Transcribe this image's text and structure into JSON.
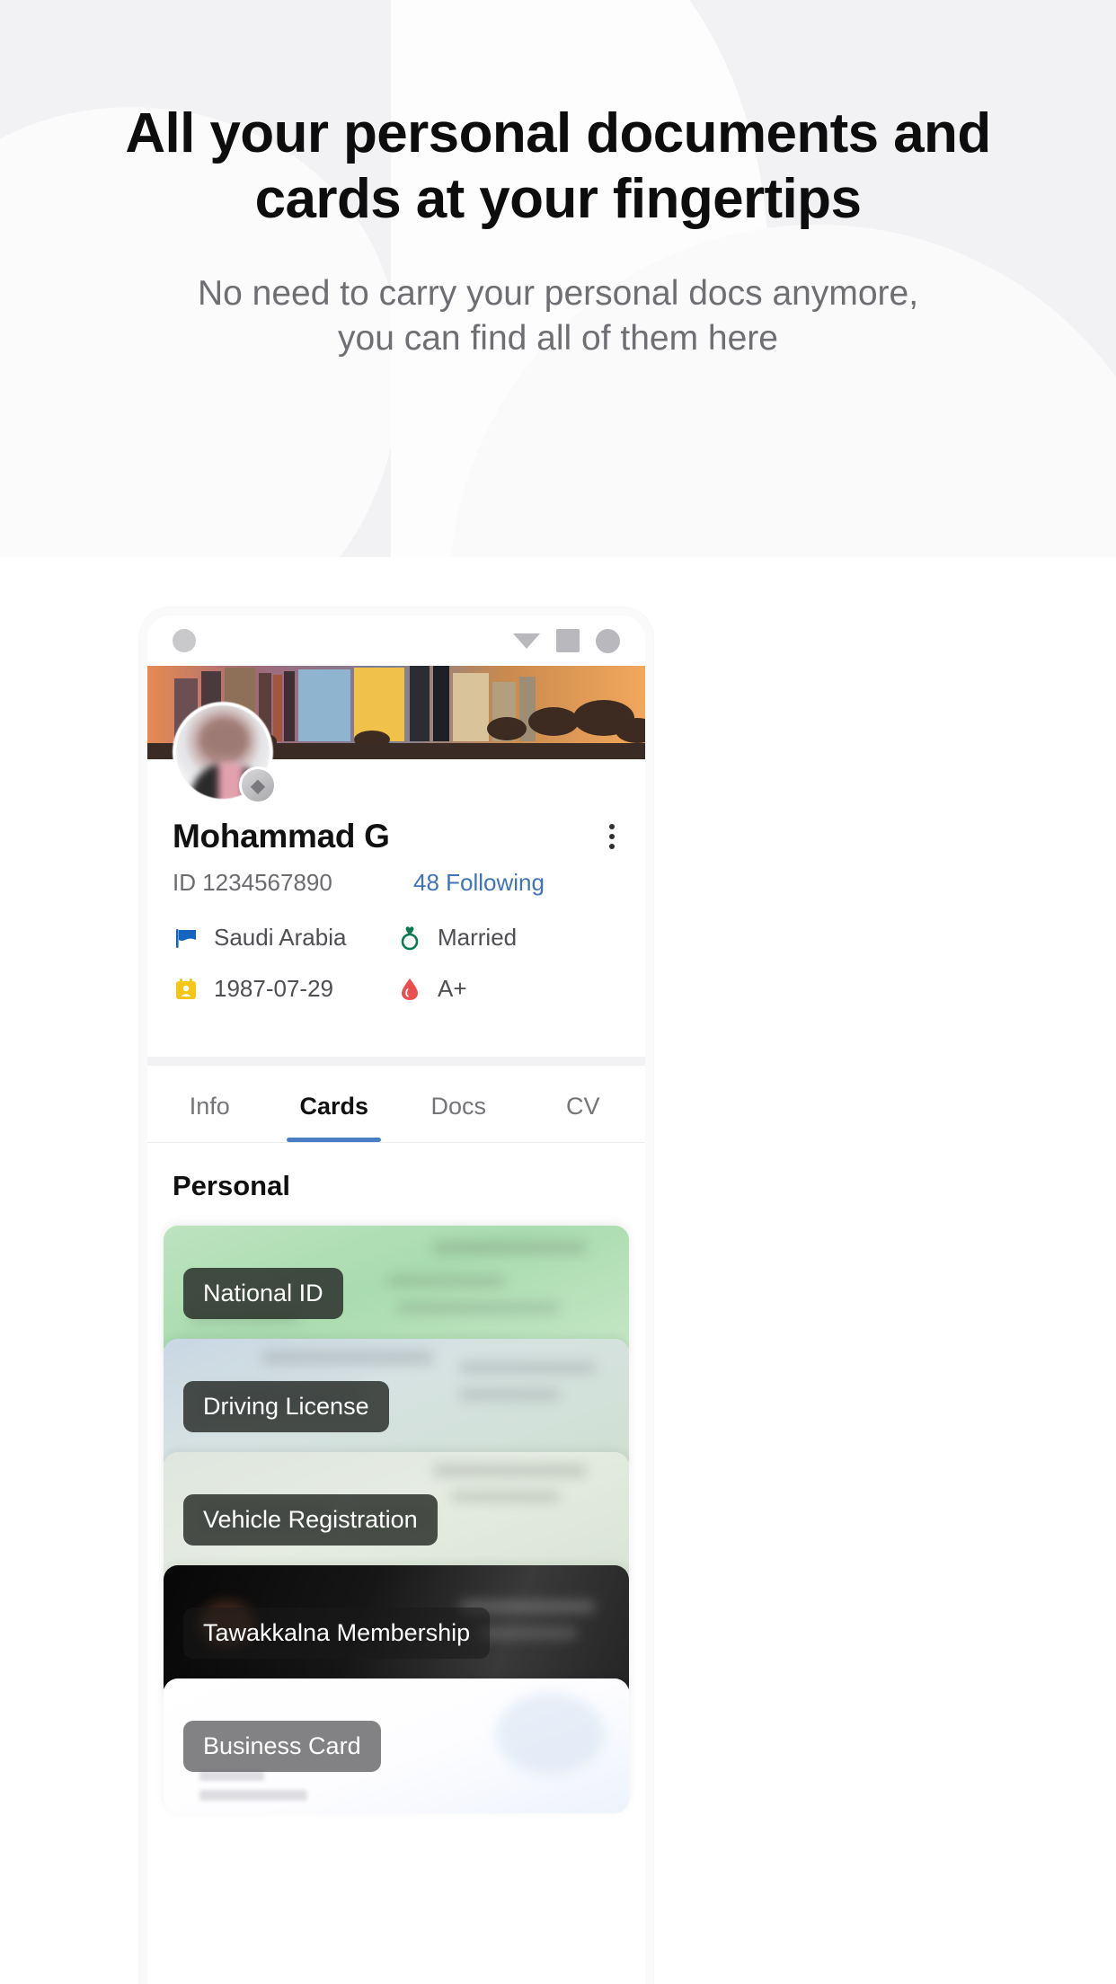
{
  "hero": {
    "headline": "All your personal documents and cards at your fingertips",
    "subheadline": "No need to carry your personal docs anymore, you can find all of them here"
  },
  "phone": {
    "statusbar": {
      "camera_icon": "camera-dot",
      "icons": [
        "triangle-icon",
        "square-icon",
        "circle-icon"
      ]
    },
    "profile": {
      "name": "Mohammad G",
      "id": "ID 1234567890",
      "following": "48 Following",
      "menu_icon": "kebab-menu-icon",
      "avatar_badge_icon": "verified-badge-icon",
      "facts": [
        {
          "icon": "flag-icon",
          "label": "Saudi Arabia"
        },
        {
          "icon": "ring-icon",
          "label": "Married"
        },
        {
          "icon": "calendar-person-icon",
          "label": "1987-07-29"
        },
        {
          "icon": "blood-drop-icon",
          "label": "A+"
        }
      ]
    },
    "tabs": [
      {
        "label": "Info",
        "active": false
      },
      {
        "label": "Cards",
        "active": true
      },
      {
        "label": "Docs",
        "active": false
      },
      {
        "label": "CV",
        "active": false
      }
    ],
    "cards_section": {
      "title": "Personal",
      "cards": [
        {
          "label": "National ID"
        },
        {
          "label": "Driving License"
        },
        {
          "label": "Vehicle Registration"
        },
        {
          "label": "Tawakkalna Membership"
        },
        {
          "label": "Business Card"
        }
      ]
    }
  },
  "colors": {
    "accent": "#4a7ec4",
    "link": "#3f74b8",
    "headline": "#0d0d0d",
    "subtext": "#6e6e73",
    "band": "#f2f2f5",
    "flag": "#1565c0",
    "ring": "#0b7a53",
    "calendar": "#f5c518",
    "blood": "#e94f4f"
  }
}
